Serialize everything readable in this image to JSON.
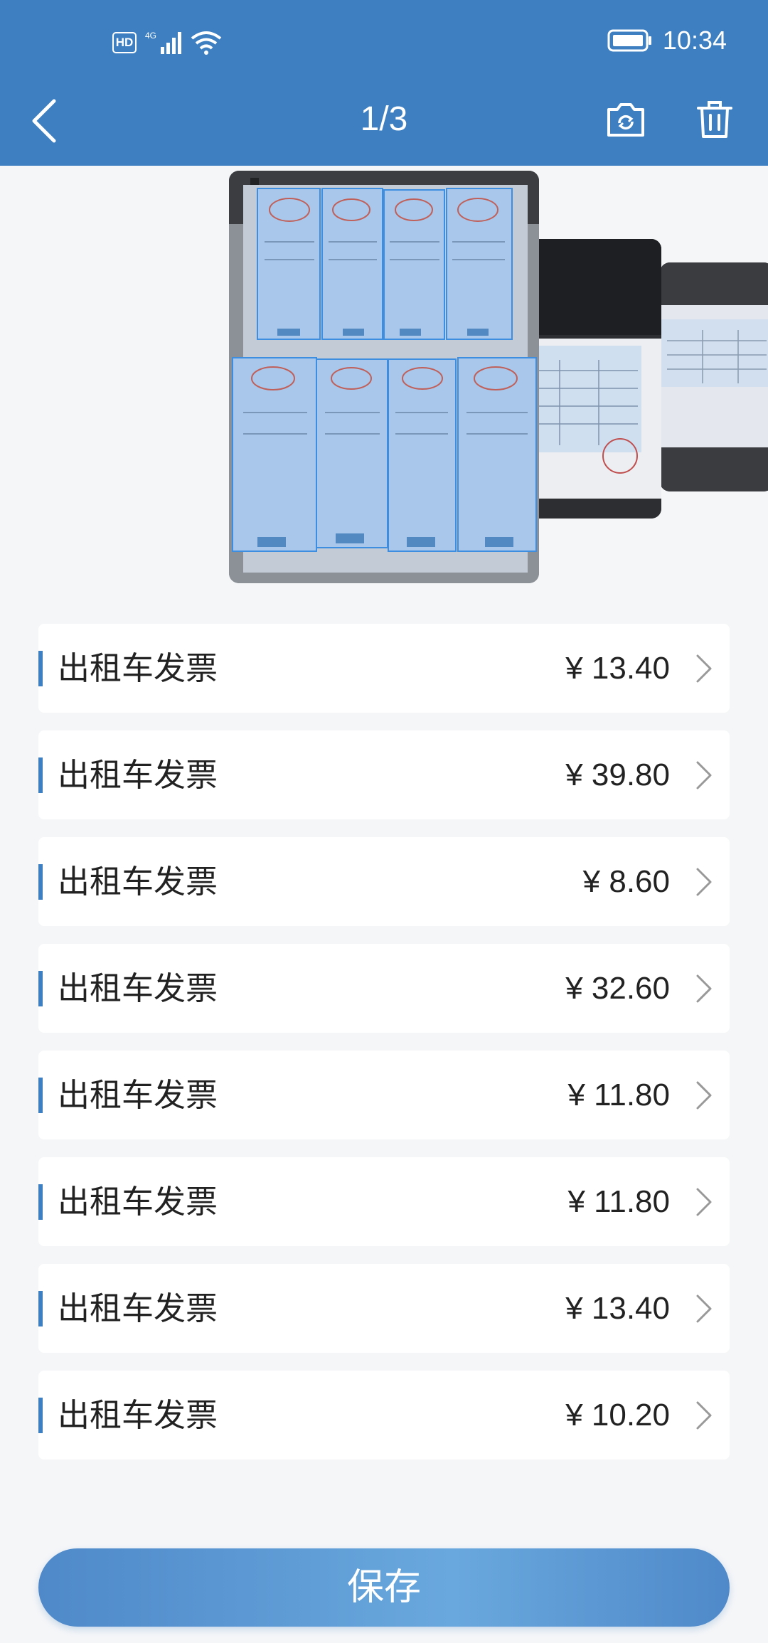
{
  "status_bar": {
    "hd": "HD",
    "network": "4G",
    "time": "10:34"
  },
  "header": {
    "page_counter": "1/3",
    "icons": {
      "back": "chevron-left-icon",
      "retake": "camera-rotate-icon",
      "delete": "trash-icon"
    }
  },
  "invoices": [
    {
      "title": "出租车发票",
      "amount": "¥ 13.40"
    },
    {
      "title": "出租车发票",
      "amount": "¥ 39.80"
    },
    {
      "title": "出租车发票",
      "amount": "¥ 8.60"
    },
    {
      "title": "出租车发票",
      "amount": "¥ 32.60"
    },
    {
      "title": "出租车发票",
      "amount": "¥ 11.80"
    },
    {
      "title": "出租车发票",
      "amount": "¥ 11.80"
    },
    {
      "title": "出租车发票",
      "amount": "¥ 13.40"
    },
    {
      "title": "出租车发票",
      "amount": "¥ 10.20"
    }
  ],
  "save_label": "保存",
  "colors": {
    "header_bg": "#3d7fc1",
    "accent": "#3d7fc1",
    "page_bg": "#f5f6f8"
  }
}
